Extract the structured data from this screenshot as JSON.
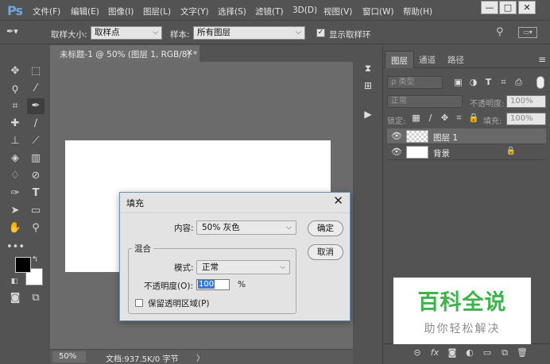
{
  "app": {
    "logo": "Ps"
  },
  "menu": [
    "文件(F)",
    "编辑(E)",
    "图像(I)",
    "图层(L)",
    "文字(Y)",
    "选择(S)",
    "滤镜(T)",
    "3D(D)",
    "视图(V)",
    "窗口(W)",
    "帮助(H)"
  ],
  "window_buttons": {
    "minimize": "—",
    "restore": "□",
    "close": "✕"
  },
  "options": {
    "sample_size_label": "取样大小:",
    "sample_size_value": "取样点",
    "sample_label": "样本:",
    "sample_value": "所有图层",
    "show_ring_label": "显示取样环",
    "show_ring_checked": true
  },
  "document": {
    "tab_title": "未标题-1 @ 50% (图层 1, RGB/8) *",
    "close": "✕",
    "zoom": "50%",
    "doc_info": "文档:937.5K/0 字节",
    "status_arrow": "〉"
  },
  "layers_panel": {
    "tabs": [
      "图层",
      "通道",
      "路径"
    ],
    "active_tab": 0,
    "filter_kind": "ρ 类型",
    "blend_mode": "正常",
    "opacity_label": "不透明度:",
    "opacity_value": "100%",
    "lock_label": "锁定:",
    "fill_label": "填充:",
    "fill_value": "100%",
    "layers": [
      {
        "name": "图层 1",
        "selected": true,
        "transparent": true,
        "locked": false
      },
      {
        "name": "背景",
        "selected": false,
        "transparent": false,
        "locked": true
      }
    ],
    "footer_icons": [
      "link-icon",
      "fx-icon",
      "mask-icon",
      "adjustment-icon",
      "group-icon",
      "new-layer-icon",
      "trash-icon"
    ]
  },
  "fill_dialog": {
    "title": "填充",
    "close": "✕",
    "content_label": "内容:",
    "content_value": "50% 灰色",
    "ok_label": "确定",
    "cancel_label": "取消",
    "blend_group_label": "混合",
    "mode_label": "模式:",
    "mode_value": "正常",
    "opacity_label": "不透明度(O):",
    "opacity_value": "100",
    "opacity_unit": "%",
    "preserve_label": "保留透明区域(P)",
    "preserve_checked": false
  },
  "watermark": {
    "title": "百科全说",
    "subtitle": "助你轻松解决"
  },
  "colors": {
    "background": "#535353",
    "canvas_area": "#6b6b6b",
    "dialog": "#e3e3e3",
    "watermark_green": "#3bb54a",
    "selection_blue": "#3a79d8"
  }
}
